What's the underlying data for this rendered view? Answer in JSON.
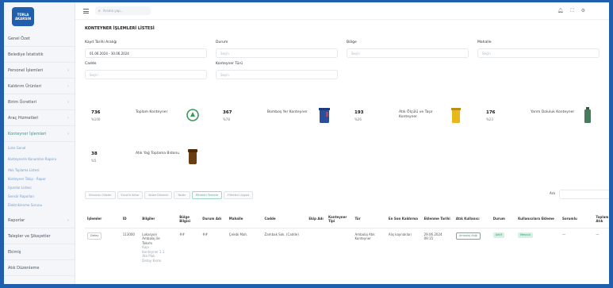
{
  "app": {
    "logo_line1": "TÜRLA",
    "logo_line2": "AKARSIN"
  },
  "sidebar": {
    "items": [
      {
        "label": "Genel Özet",
        "chevron": false
      },
      {
        "label": "Belediye İstatistik",
        "chevron": false
      },
      {
        "label": "Personel İşlemleri",
        "chevron": true
      },
      {
        "label": "Kaldırım Ürünleri",
        "chevron": true
      },
      {
        "label": "Birim Ücretleri",
        "chevron": true
      },
      {
        "label": "Araç Hizmetleri",
        "chevron": true
      },
      {
        "label": "Konteyner İşlemleri",
        "chevron": true,
        "active": true
      }
    ],
    "sub_items": [
      {
        "label": "Liste Genel",
        "two_line": false
      },
      {
        "label": "Konteynerin Konumları Raporu",
        "two_line": true
      },
      {
        "label": "Atık Toplama Listesi",
        "two_line": false
      },
      {
        "label": "Konteyner Takip - Rapor",
        "two_line": false
      },
      {
        "label": "Uyarılar Listesi",
        "two_line": false
      },
      {
        "label": "Sensör Raporları",
        "two_line": false
      },
      {
        "label": "Elektriklenme Sorunu",
        "two_line": false
      }
    ],
    "bottom_items": [
      {
        "label": "Raporlar",
        "chevron": true
      },
      {
        "label": "Talepler ve Şikayetler",
        "chevron": false
      },
      {
        "label": "Ekimiş",
        "chevron": false
      },
      {
        "label": "Atık Düzenleme",
        "chevron": false
      }
    ]
  },
  "topbar": {
    "search_placeholder": "Arama yap..."
  },
  "page": {
    "title": "KONTEYNER İŞLEMLERİ LİSTESİ"
  },
  "filters": [
    {
      "label": "Kayıt Tarihi Aralığı",
      "value": "01.06.2024 - 30.06.2024",
      "dark": true
    },
    {
      "label": "Durum",
      "value": "Seçin",
      "dark": false
    },
    {
      "label": "Bölge",
      "value": "Seçin",
      "dark": false
    },
    {
      "label": "Mahalle",
      "value": "Seçin",
      "dark": false
    },
    {
      "label": "Cadde",
      "value": "Seçin",
      "dark": false
    },
    {
      "label": "Konteyner Türü",
      "value": "Seçin",
      "dark": false
    }
  ],
  "stats": [
    {
      "num": "736",
      "pct": "%100",
      "label": "Toplam Konteyner",
      "icon": "recycle-icon"
    },
    {
      "num": "367",
      "pct": "%78",
      "label": "Bomboş Yer Konteyner",
      "icon": "blue-bin-icon"
    },
    {
      "num": "193",
      "pct": "%26",
      "label": "Atık Ölçülü ve Taşır Konteyner",
      "icon": "yellow-bin-icon"
    },
    {
      "num": "176",
      "pct": "%23",
      "label": "Yarım Doluluk Konteyner",
      "icon": "green-bin-icon"
    },
    {
      "num": "38",
      "pct": "%5",
      "label": "Atık Yağ Toplama Bidonu",
      "icon": "brown-bin-icon"
    }
  ],
  "table_tools": {
    "buttons": [
      "Sütunları Göster",
      "Excel'e Aktar",
      "Kolon Düzenle",
      "Yazdır",
      "Filtreleri Temizle",
      "Filtreleri Uygula"
    ],
    "search_label": "Ara"
  },
  "table": {
    "headers": [
      "İşlemler",
      "ID",
      "Bilgiler",
      "Bölge Bilgisi",
      "Durum Adı",
      "Mahalle",
      "Cadde",
      "Ekip Adı",
      "Konteyner Tipi",
      "Tür",
      "En Son Kaldırma",
      "Eklenme Tarihi",
      "Atık Kullanıcı",
      "Durum",
      "Kullanıcılara Ekleme",
      "Sorumlu",
      "Toplam Atık"
    ],
    "rows": [
      {
        "action": "Detay",
        "id": "113000",
        "info_lines": [
          "Lokasyon",
          "Ambalaj ile",
          "Takımı",
          "Kapı",
          "Konteyner 1.1",
          "Ata Plak",
          "Detay Kısmı"
        ],
        "region": "##",
        "status_name": "##",
        "district": "Çelebi Mah.",
        "street": "Zambak Sok. (Cadde)",
        "team": "",
        "container_type": "",
        "kind": "Ambalaj Atık Konteyner",
        "last_pick": "Alış kaynakları",
        "added": "29.06.2024 09:15",
        "waste_user": "Ambalaj Atığı",
        "state": "Aktif",
        "added_users": "Mevcut",
        "responsible": "—",
        "total": "—"
      }
    ]
  },
  "colors": {
    "frame": "#1f5fae",
    "accent": "#2a9d8f",
    "active_badge": "#d4f1e4"
  }
}
